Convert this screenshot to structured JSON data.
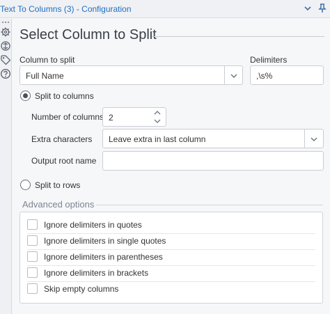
{
  "window": {
    "title": "Text To Columns (3) - Configuration"
  },
  "page": {
    "heading": "Select Column to Split"
  },
  "column_to_split": {
    "label": "Column to split",
    "value": "Full Name"
  },
  "delimiters": {
    "label": "Delimiters",
    "value": ",\\s%"
  },
  "split_to_columns": {
    "label": "Split to columns",
    "checked": true,
    "number_of_columns": {
      "label": "Number of columns",
      "value": "2"
    },
    "extra_characters": {
      "label": "Extra characters",
      "value": "Leave extra in last column"
    },
    "output_root_name": {
      "label": "Output root name",
      "value": ""
    }
  },
  "split_to_rows": {
    "label": "Split to rows",
    "checked": false
  },
  "advanced": {
    "label": "Advanced options",
    "options": [
      {
        "label": "Ignore delimiters in quotes",
        "checked": false
      },
      {
        "label": "Ignore delimiters in single quotes",
        "checked": false
      },
      {
        "label": "Ignore delimiters in parentheses",
        "checked": false
      },
      {
        "label": "Ignore delimiters in brackets",
        "checked": false
      },
      {
        "label": "Skip empty columns",
        "checked": false
      }
    ]
  },
  "colors": {
    "title_blue": "#1f6fc2",
    "background": "#f6f7f9"
  }
}
